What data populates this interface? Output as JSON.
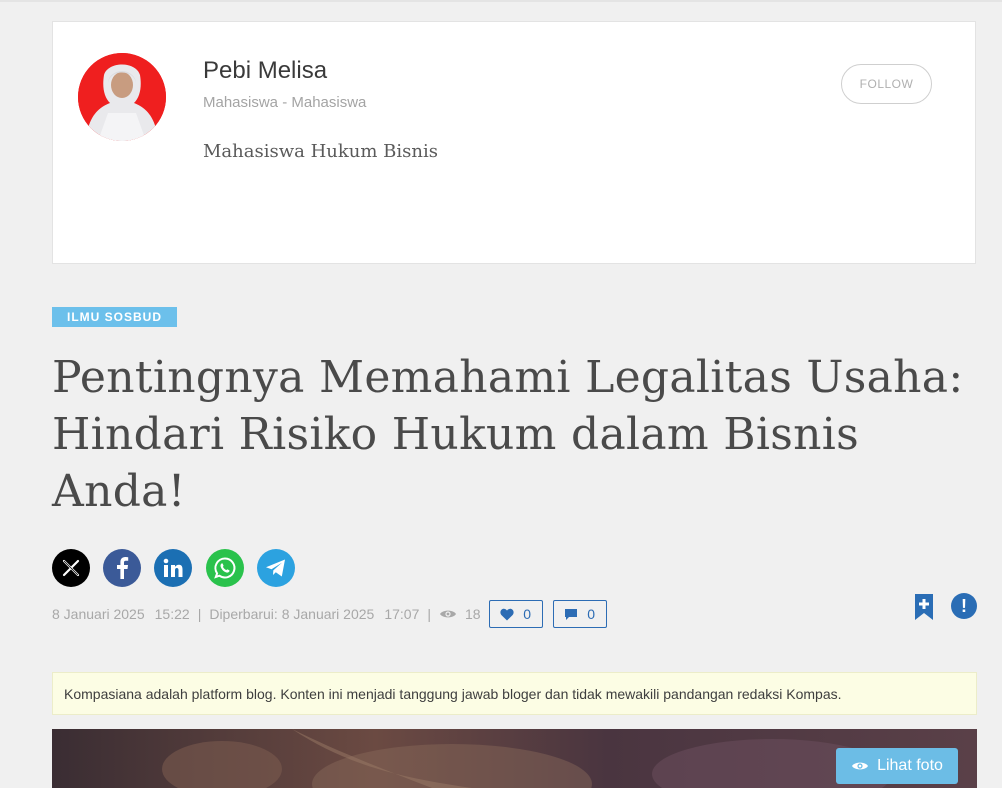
{
  "author": {
    "name": "Pebi Melisa",
    "role": "Mahasiswa - Mahasiswa",
    "bio": "Mahasiswa Hukum Bisnis",
    "follow_label": "FOLLOW"
  },
  "article": {
    "category": "ILMU SOSBUD",
    "title": "Pentingnya Memahami Legalitas Usaha: Hindari Risiko Hukum dalam Bisnis Anda!",
    "share": [
      "x-icon",
      "facebook-icon",
      "linkedin-icon",
      "whatsapp-icon",
      "telegram-icon"
    ],
    "published_date": "8 Januari 2025",
    "published_time": "15:22",
    "updated_label": "Diperbarui: 8 Januari 2025",
    "updated_time": "17:07",
    "views": "18",
    "likes": "0",
    "comments": "0",
    "separator": "|"
  },
  "disclaimer": "Kompasiana adalah platform blog. Konten ini menjadi tanggung jawab bloger dan tidak mewakili pandangan redaksi Kompas.",
  "hero": {
    "view_photo_label": "Lihat foto"
  },
  "colors": {
    "accent": "#2c6cb4",
    "category_bg": "#6cc0eb",
    "avatar_bg": "#ef1f1f"
  }
}
